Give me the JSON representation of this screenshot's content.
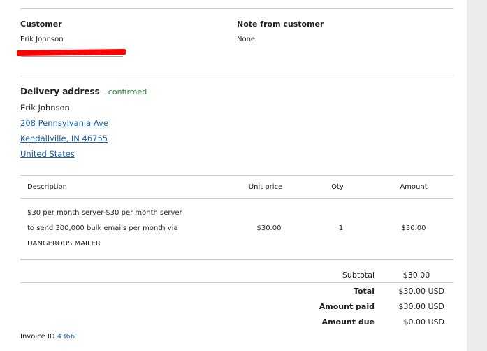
{
  "customer": {
    "label": "Customer",
    "name": "Erik Johnson"
  },
  "note": {
    "label": "Note from customer",
    "value": "None"
  },
  "delivery": {
    "label": "Delivery address",
    "separator": " - ",
    "status": "confirmed",
    "name": "Erik Johnson",
    "street": "208 Pennsylvania Ave",
    "city": "Kendallville, IN 46755",
    "country": "United States"
  },
  "table": {
    "headers": {
      "description": "Description",
      "unit_price": "Unit price",
      "qty": "Qty",
      "amount": "Amount"
    },
    "row": {
      "description_lines": [
        "$30 per month server-$30 per month server",
        "to send 300,000 bulk emails per month via",
        "DANGEROUS MAILER"
      ],
      "unit_price": "$30.00",
      "qty": "1",
      "amount": "$30.00"
    }
  },
  "totals": {
    "subtotal_label": "Subtotal",
    "subtotal_value": "$30.00",
    "total_label": "Total",
    "total_value": "$30.00 USD",
    "paid_label": "Amount paid",
    "paid_value": "$30.00 USD",
    "due_label": "Amount due",
    "due_value": "$0.00 USD"
  },
  "invoice": {
    "label": "Invoice ID",
    "id": "4366"
  },
  "colors": {
    "link": "#1d5fa8",
    "confirmed": "#2c8a2c",
    "redaction": "#ff0000"
  }
}
